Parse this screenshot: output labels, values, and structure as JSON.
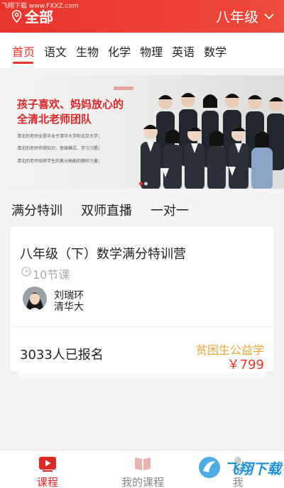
{
  "watermark_top": "飞翔下载 www.FXXZ.com",
  "header": {
    "location_label": "全部",
    "grade_label": "八年级"
  },
  "tabs": [
    {
      "label": "首页",
      "active": true
    },
    {
      "label": "语文",
      "active": false
    },
    {
      "label": "生物",
      "active": false
    },
    {
      "label": "化学",
      "active": false
    },
    {
      "label": "物理",
      "active": false
    },
    {
      "label": "英语",
      "active": false
    },
    {
      "label": "数学",
      "active": false
    }
  ],
  "banner": {
    "headline1": "孩子喜欢、妈妈放心的",
    "headline2": "全清北老师团队",
    "lines": [
      "清北的老师全是毕业于清华大学和北京大学；",
      "清北的老师传授知识、思维模式、学习习惯；",
      "清北的老师培养学生的奥分高能的榜样力量；"
    ]
  },
  "section_tabs": [
    "满分特训",
    "双师直播",
    "一对一"
  ],
  "course": {
    "title": "八年级（下）数学满分特训营",
    "lessons": "10节课",
    "teacher_name": "刘瑞环",
    "teacher_school": "清华大",
    "enrolled": "3033人已报名",
    "subsidy": "贫困生公益学",
    "price": "￥799"
  },
  "bottom_nav": [
    {
      "label": "课程",
      "active": true
    },
    {
      "label": "我的课程",
      "active": false
    },
    {
      "label": "我",
      "active": false
    }
  ],
  "watermark_bottom": "飞翔下载",
  "colors": {
    "accent": "#e8342c",
    "subsidy": "#e9a53c",
    "watermark": "#1f8fd6"
  }
}
